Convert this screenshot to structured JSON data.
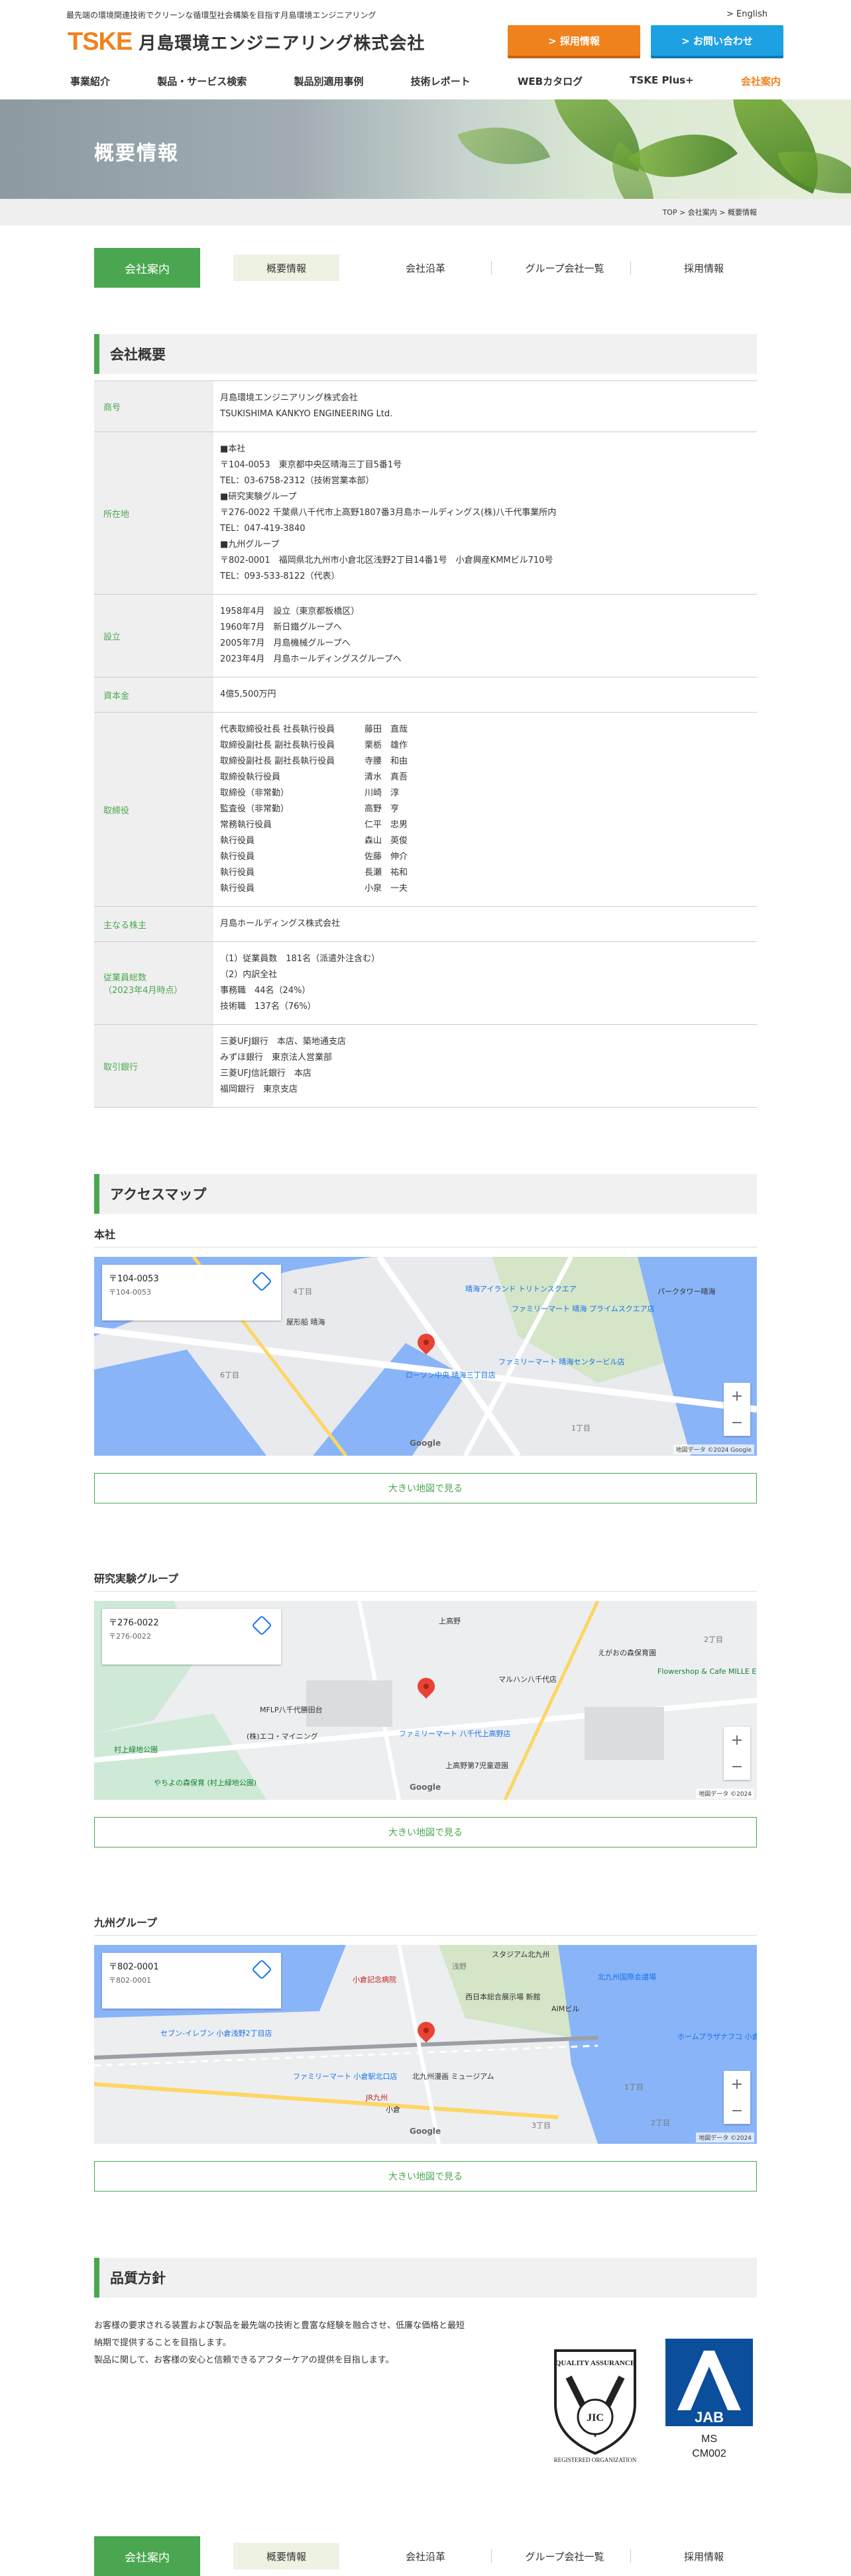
{
  "header": {
    "tagline": "最先端の環境関連技術でクリーンな循環型社会構築を目指す月島環境エンジニアリング",
    "english": "> English",
    "logo_mark": "TSKE",
    "logo_name": "月島環境エンジニアリング株式会社",
    "recruit_btn": "> 採用情報",
    "contact_btn": "> お問い合わせ",
    "nav": [
      "事業紹介",
      "製品・サービス検索",
      "製品別適用事例",
      "技術レポート",
      "WEBカタログ",
      "TSKE Plus+",
      "会社案内"
    ]
  },
  "hero": {
    "title": "概要情報"
  },
  "breadcrumb": "TOP > 会社案内 > 概要情報",
  "subnav": [
    "会社案内",
    "概要情報",
    "会社沿革",
    "グループ会社一覧",
    "採用情報"
  ],
  "overview": {
    "title": "会社概要",
    "rows": {
      "name_label": "商号",
      "name_lines": [
        "月島環境エンジニアリング株式会社",
        "TSUKISHIMA KANKYO ENGINEERING Ltd."
      ],
      "addr_label": "所在地",
      "addr_lines": [
        "■本社",
        "〒104-0053　東京都中央区晴海三丁目5番1号",
        "TEL：03-6758-2312（技術営業本部）",
        "■研究実験グループ",
        "〒276-0022 千葉県八千代市上高野1807番3月島ホールディングス(株)八千代事業所内",
        "TEL：047-419-3840",
        "■九州グループ",
        "〒802-0001　福岡県北九州市小倉北区浅野2丁目14番1号　小倉興産KMMビル710号",
        "TEL：093-533-8122（代表）"
      ],
      "est_label": "設立",
      "est_lines": [
        "1958年4月　設立（東京都板橋区）",
        "1960年7月　新日鐵グループへ",
        "2005年7月　月島機械グループへ",
        "2023年4月　月島ホールディングスグループへ"
      ],
      "capital_label": "資本金",
      "capital": "4億5,500万円",
      "officers_label": "取締役",
      "officers": [
        [
          "代表取締役社長 社長執行役員",
          "藤田　直哉"
        ],
        [
          "取締役副社長 副社長執行役員",
          "栗栃　雄作"
        ],
        [
          "取締役副社長 副社長執行役員",
          "寺腰　和由"
        ],
        [
          "取締役執行役員",
          "清水　真吾"
        ],
        [
          "取締役（非常勤）",
          "川崎　淳"
        ],
        [
          "監査役（非常勤）",
          "高野　亨"
        ],
        [
          "常務執行役員",
          "仁平　忠男"
        ],
        [
          "執行役員",
          "森山　英俊"
        ],
        [
          "執行役員",
          "佐藤　伸介"
        ],
        [
          "執行役員",
          "長瀬　祐和"
        ],
        [
          "執行役員",
          "小泉　一夫"
        ]
      ],
      "holder_label": "主なる株主",
      "holder": "月島ホールディングス株式会社",
      "emp_label_1": "従業員総数",
      "emp_label_2": "（2023年4月時点）",
      "emp_lines": [
        "（1）従業員数　181名（派遣外注含む）",
        "（2）内訳全社",
        "事務職　44名（24%）",
        "技術職　137名（76%）"
      ],
      "bank_label": "取引銀行",
      "bank_lines": [
        "三菱UFJ銀行　本店、築地通支店",
        "みずほ銀行　東京法人営業部",
        "三菱UFJ信託銀行　本店",
        "福岡銀行　東京支店"
      ]
    }
  },
  "access": {
    "title": "アクセスマップ",
    "maps": [
      {
        "label": "本社",
        "zip": "〒104-0053",
        "zip_sub": "〒104-0053",
        "button": "大きい地図で見る",
        "places": [
          "晴海アイランド トリトンスクエア",
          "ファミリーマート 晴海 プライムスクエア店",
          "ローソン中央 晴海三丁目店",
          "ファミリーマート 晴海センタービル店",
          "パークタワー晴海",
          "屋形船 晴海",
          "4丁目",
          "6丁目",
          "1丁目"
        ],
        "copyright": "地図データ ©2024 Google"
      },
      {
        "label": "研究実験グループ",
        "zip": "〒276-0022",
        "zip_sub": "〒276-0022",
        "button": "大きい地図で見る",
        "places": [
          "上高野",
          "マルハン八千代店",
          "MFLP八千代勝田台",
          "(株)エコ・マイニング",
          "ファミリーマート 八千代上高野店",
          "上高野第7児童遊園",
          "えがおの森保育園",
          "Flowershop & Cafe MILLE ECLAT",
          "村上緑地公園",
          "やちよの森保育 (村上緑地公園)",
          "2丁目"
        ],
        "copyright": "地図データ ©2024"
      },
      {
        "label": "九州グループ",
        "zip": "〒802-0001",
        "zip_sub": "〒802-0001",
        "button": "大きい地図で見る",
        "places": [
          "スタジアム北九州",
          "浅野",
          "北九州国際会議場",
          "西日本総合展示場 新館",
          "AIMビル",
          "ホームプラザナフコ 小倉駅北口店",
          "小倉記念病院",
          "セブン-イレブン 小倉浅野2丁目店",
          "ファミリーマート 小倉駅北口店",
          "北九州漫画 ミュージアム",
          "JR九州",
          "小倉",
          "1丁目",
          "2丁目",
          "3丁目"
        ],
        "copyright": "地図データ ©2024"
      }
    ]
  },
  "quality": {
    "title": "品質方針",
    "lines": [
      "お客様の要求される装置および製品を最先端の技術と豊富な経験を融合させ、低廉な価格と最短",
      "納期で提供することを目指します。",
      "製品に関して、お客様の安心と信頼できるアフターケアの提供を目指します。"
    ],
    "qa_top": "QUALITY ASSURANCE",
    "qa_center": "JIC",
    "qa_bottom": "REGISTERED ORGANIZATION",
    "jab": "JAB",
    "jab_ms": "MS",
    "jab_code": "CM002"
  },
  "colors": {
    "accent_green": "#4aa750",
    "accent_orange": "#f0821e",
    "accent_blue": "#1da1e2"
  }
}
